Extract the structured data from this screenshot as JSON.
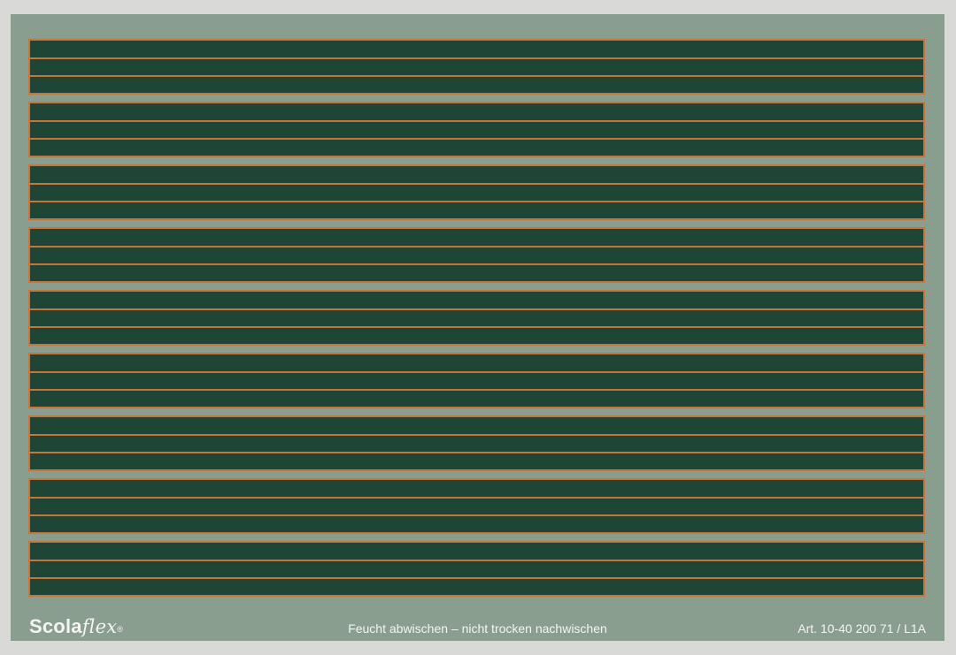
{
  "board": {
    "colors": {
      "frame": "#8a9e8f",
      "surface": "#1f4536",
      "ruling": "#c8733a",
      "background": "#d9dad8",
      "text": "#f3f5f3"
    },
    "rows": 9
  },
  "footer": {
    "logo_main": "Scola",
    "logo_italic": "flex",
    "logo_reg": "®",
    "instruction": "Feucht abwischen – nicht trocken nachwischen",
    "article_number": "Art. 10-40 200 71 / L1A"
  }
}
